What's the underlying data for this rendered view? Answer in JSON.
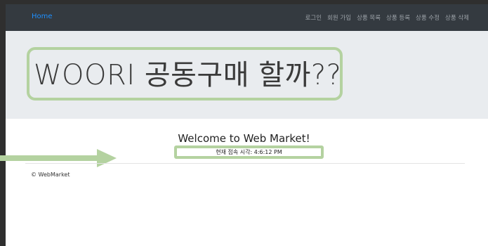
{
  "navbar": {
    "brand": "Home",
    "links": [
      "로그인",
      "회원 가입",
      "상품 목록",
      "상품 등록",
      "상품 수정",
      "상품 삭제"
    ]
  },
  "hero": {
    "title": "WOORI 공동구매 할까??"
  },
  "main": {
    "welcome": "Welcome to Web Market!",
    "time_label": "현재 접속 시각:",
    "time_value": "4:6:12 PM"
  },
  "footer": {
    "text": "© WebMarket"
  },
  "colors": {
    "navbar_bg": "#343a40",
    "brand": "#1e90ff",
    "jumbotron_bg": "#e9ecef",
    "highlight": "#b4d2a0"
  }
}
